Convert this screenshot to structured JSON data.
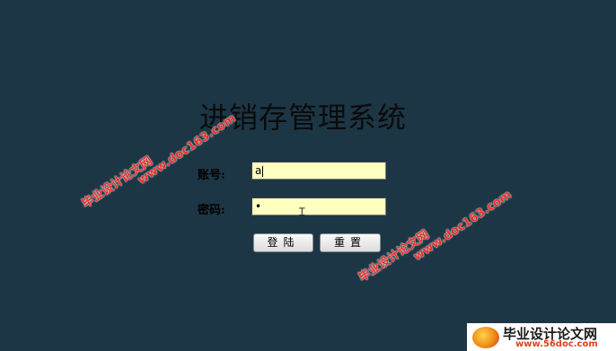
{
  "title": "进销存管理系统",
  "form": {
    "account_label": "账号:",
    "account_value": "a",
    "password_label": "密码:",
    "password_value": "•",
    "login_button": "登陆",
    "reset_button": "重置"
  },
  "watermarks": {
    "cn": "毕业设计论文网",
    "url": "www.doc163.com"
  },
  "badge": {
    "cn": "毕业设计论文网",
    "url": "www.56doc.com"
  },
  "colors": {
    "background": "#1c3646",
    "field": "#ffffbf",
    "watermark": "#e8302a"
  },
  "icons": {
    "cursor": "text-cursor-icon",
    "logo": "logo-ball-icon"
  }
}
